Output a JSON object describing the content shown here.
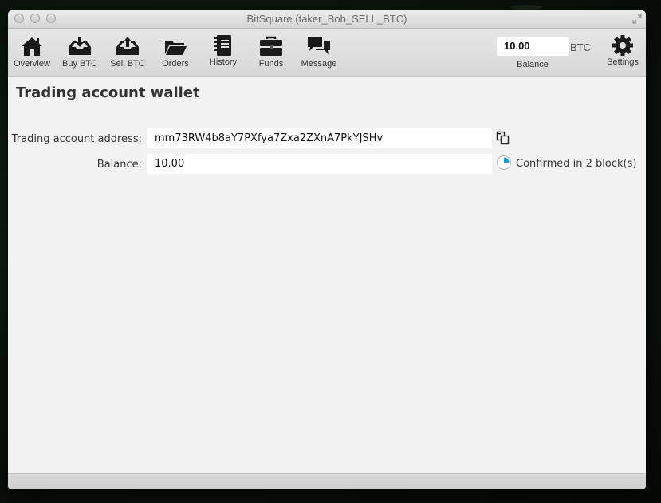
{
  "window": {
    "title": "BitSquare (taker_Bob_SELL_BTC)"
  },
  "toolbar": {
    "items": [
      {
        "label": "Overview",
        "icon": "home-icon"
      },
      {
        "label": "Buy BTC",
        "icon": "buy-tray-icon"
      },
      {
        "label": "Sell BTC",
        "icon": "sell-tray-icon"
      },
      {
        "label": "Orders",
        "icon": "folder-icon"
      },
      {
        "label": "History",
        "icon": "notebook-icon"
      },
      {
        "label": "Funds",
        "icon": "briefcase-icon"
      },
      {
        "label": "Message",
        "icon": "chat-bubbles-icon"
      }
    ],
    "balance": {
      "value": "10.00",
      "unit": "BTC",
      "caption": "Balance"
    },
    "settings_label": "Settings"
  },
  "main": {
    "title": "Trading account wallet",
    "address_label": "Trading account address:",
    "address_value": "mm73RW4b8aY7PXfya7Zxa2ZXnA7PkYJSHv",
    "balance_label": "Balance:",
    "balance_value": "10.00",
    "confirmation_text": "Confirmed in 2 block(s)",
    "confirmation_progress": 0.25
  },
  "colors": {
    "accent": "#1a9cd6",
    "window_bg": "#f2f2f2"
  }
}
